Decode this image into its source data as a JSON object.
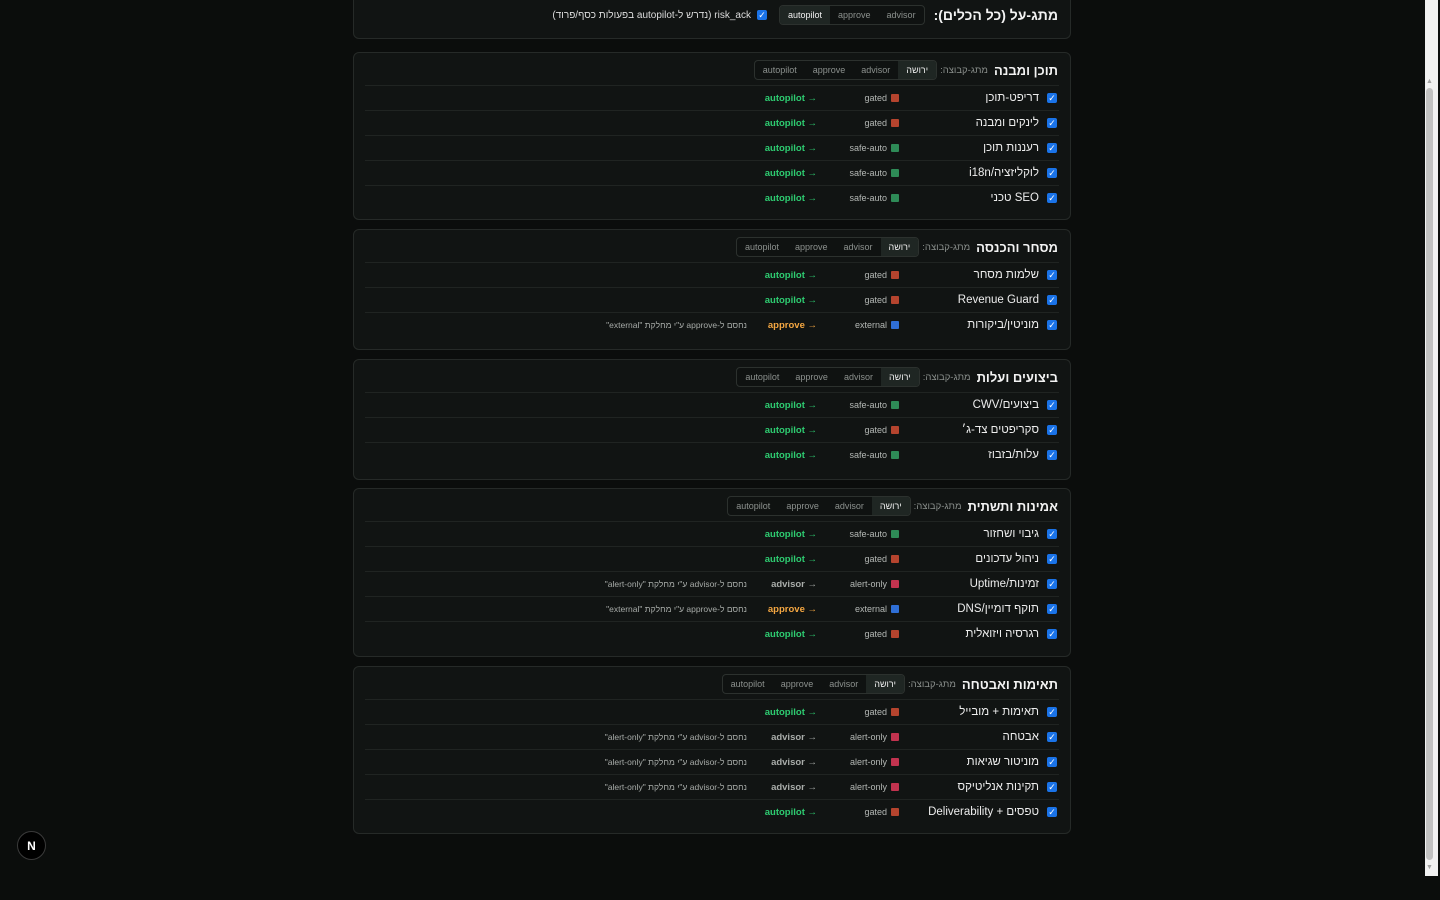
{
  "global": {
    "title": "מתג-על (כל הכלים):",
    "modes": [
      "advisor",
      "approve",
      "autopilot"
    ],
    "active": "autopilot",
    "risk_ack": "risk_ack (נדרש ל-autopilot בפעולות כסף/פרוד)"
  },
  "subgroup_label": "מתג-קבוצה:",
  "group_modes": [
    "ירושה",
    "advisor",
    "approve",
    "autopilot"
  ],
  "colors": {
    "gated": "#b5442e",
    "safe-auto": "#2e8b57",
    "external": "#2f6fd6",
    "alert-only": "#c2334f"
  },
  "groups": [
    {
      "title": "תוכן ומבנה",
      "rows": [
        {
          "name": "דריפט-תוכן",
          "cls": "gated",
          "mode": "autopilot",
          "mode_text": "autopilot →",
          "note": ""
        },
        {
          "name": "לינקים ומבנה",
          "cls": "gated",
          "mode": "autopilot",
          "mode_text": "autopilot →",
          "note": ""
        },
        {
          "name": "רעננות תוכן",
          "cls": "safe-auto",
          "mode": "autopilot",
          "mode_text": "autopilot →",
          "note": ""
        },
        {
          "name": "לוקליזציה/i18n",
          "cls": "safe-auto",
          "mode": "autopilot",
          "mode_text": "autopilot →",
          "note": ""
        },
        {
          "name": "SEO טכני",
          "cls": "safe-auto",
          "mode": "autopilot",
          "mode_text": "autopilot →",
          "note": ""
        }
      ]
    },
    {
      "title": "מסחר והכנסה",
      "rows": [
        {
          "name": "שלמות מסחר",
          "cls": "gated",
          "mode": "autopilot",
          "mode_text": "autopilot →",
          "note": ""
        },
        {
          "name": "Revenue Guard",
          "cls": "gated",
          "mode": "autopilot",
          "mode_text": "autopilot →",
          "note": ""
        },
        {
          "name": "מוניטין/ביקורות",
          "cls": "external",
          "mode": "approve",
          "mode_text": "approve →",
          "note": "נחסם ל-approve ע\"י מחלקת \"external\""
        }
      ]
    },
    {
      "title": "ביצועים ועלות",
      "rows": [
        {
          "name": "ביצועים/CWV",
          "cls": "safe-auto",
          "mode": "autopilot",
          "mode_text": "autopilot →",
          "note": ""
        },
        {
          "name": "סקריפטים צד-ג׳",
          "cls": "gated",
          "mode": "autopilot",
          "mode_text": "autopilot →",
          "note": ""
        },
        {
          "name": "עלות/בזבוז",
          "cls": "safe-auto",
          "mode": "autopilot",
          "mode_text": "autopilot →",
          "note": ""
        }
      ]
    },
    {
      "title": "אמינות ותשתית",
      "rows": [
        {
          "name": "גיבוי ושחזור",
          "cls": "safe-auto",
          "mode": "autopilot",
          "mode_text": "autopilot →",
          "note": ""
        },
        {
          "name": "ניהול עדכונים",
          "cls": "gated",
          "mode": "autopilot",
          "mode_text": "autopilot →",
          "note": ""
        },
        {
          "name": "זמינות/Uptime",
          "cls": "alert-only",
          "mode": "advisor",
          "mode_text": "advisor →",
          "note": "נחסם ל-advisor ע\"י מחלקת \"alert-only\""
        },
        {
          "name": "תוקף דומיין/DNS",
          "cls": "external",
          "mode": "approve",
          "mode_text": "approve →",
          "note": "נחסם ל-approve ע\"י מחלקת \"external\""
        },
        {
          "name": "רגרסיה ויזואלית",
          "cls": "gated",
          "mode": "autopilot",
          "mode_text": "autopilot →",
          "note": ""
        }
      ]
    },
    {
      "title": "תאימות ואבטחה",
      "rows": [
        {
          "name": "תאימות + מובייל",
          "cls": "gated",
          "mode": "autopilot",
          "mode_text": "autopilot →",
          "note": ""
        },
        {
          "name": "אבטחה",
          "cls": "alert-only",
          "mode": "advisor",
          "mode_text": "advisor →",
          "note": "נחסם ל-advisor ע\"י מחלקת \"alert-only\""
        },
        {
          "name": "מוניטור שגיאות",
          "cls": "alert-only",
          "mode": "advisor",
          "mode_text": "advisor →",
          "note": "נחסם ל-advisor ע\"י מחלקת \"alert-only\""
        },
        {
          "name": "תקינות אנליטיקס",
          "cls": "alert-only",
          "mode": "advisor",
          "mode_text": "advisor →",
          "note": "נחסם ל-advisor ע\"י מחלקת \"alert-only\""
        },
        {
          "name": "טפסים + Deliverability",
          "cls": "gated",
          "mode": "autopilot",
          "mode_text": "autopilot →",
          "note": ""
        }
      ]
    }
  ],
  "fab_label": "N"
}
